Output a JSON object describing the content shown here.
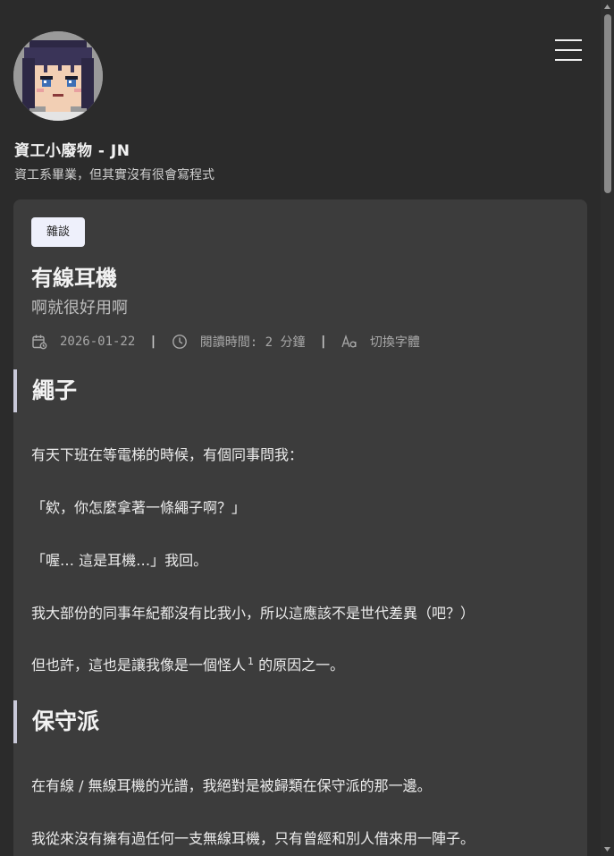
{
  "site": {
    "title": "資工小廢物 - JN",
    "description": "資工系畢業，但其實沒有很會寫程式"
  },
  "post": {
    "category": "雜談",
    "title": "有線耳機",
    "subtitle": "啊就很好用啊",
    "date": "2026-01-22",
    "reading_time": "閱讀時間: 2 分鐘",
    "font_toggle": "切換字體",
    "separator": "|"
  },
  "sections": [
    {
      "heading": "繩子",
      "paragraphs": [
        "有天下班在等電梯的時候，有個同事問我：",
        "「欸，你怎麼拿著一條繩子啊？」",
        "「喔… 這是耳機…」我回。",
        "我大部份的同事年紀都沒有比我小，所以這應該不是世代差異（吧？）"
      ],
      "last_paragraph": {
        "before": "但也許，這也是讓我像是一個怪人",
        "footnote": "1",
        "after": " 的原因之一。"
      }
    },
    {
      "heading": "保守派",
      "paragraphs": [
        "在有線 / 無線耳機的光譜，我絕對是被歸類在保守派的那一邊。",
        "我從來沒有擁有過任何一支無線耳機，只有曾經和別人借來用一陣子。"
      ]
    }
  ],
  "icons": {
    "avatar": "pixel-avatar",
    "menu": "hamburger-icon",
    "date": "calendar-icon",
    "time": "clock-icon",
    "font": "font-aa-icon"
  },
  "colors": {
    "background": "#2b2b2b",
    "card": "#3c3c3c",
    "tag_bg": "#eef0fb",
    "accent_bar": "#c9c9d9"
  }
}
